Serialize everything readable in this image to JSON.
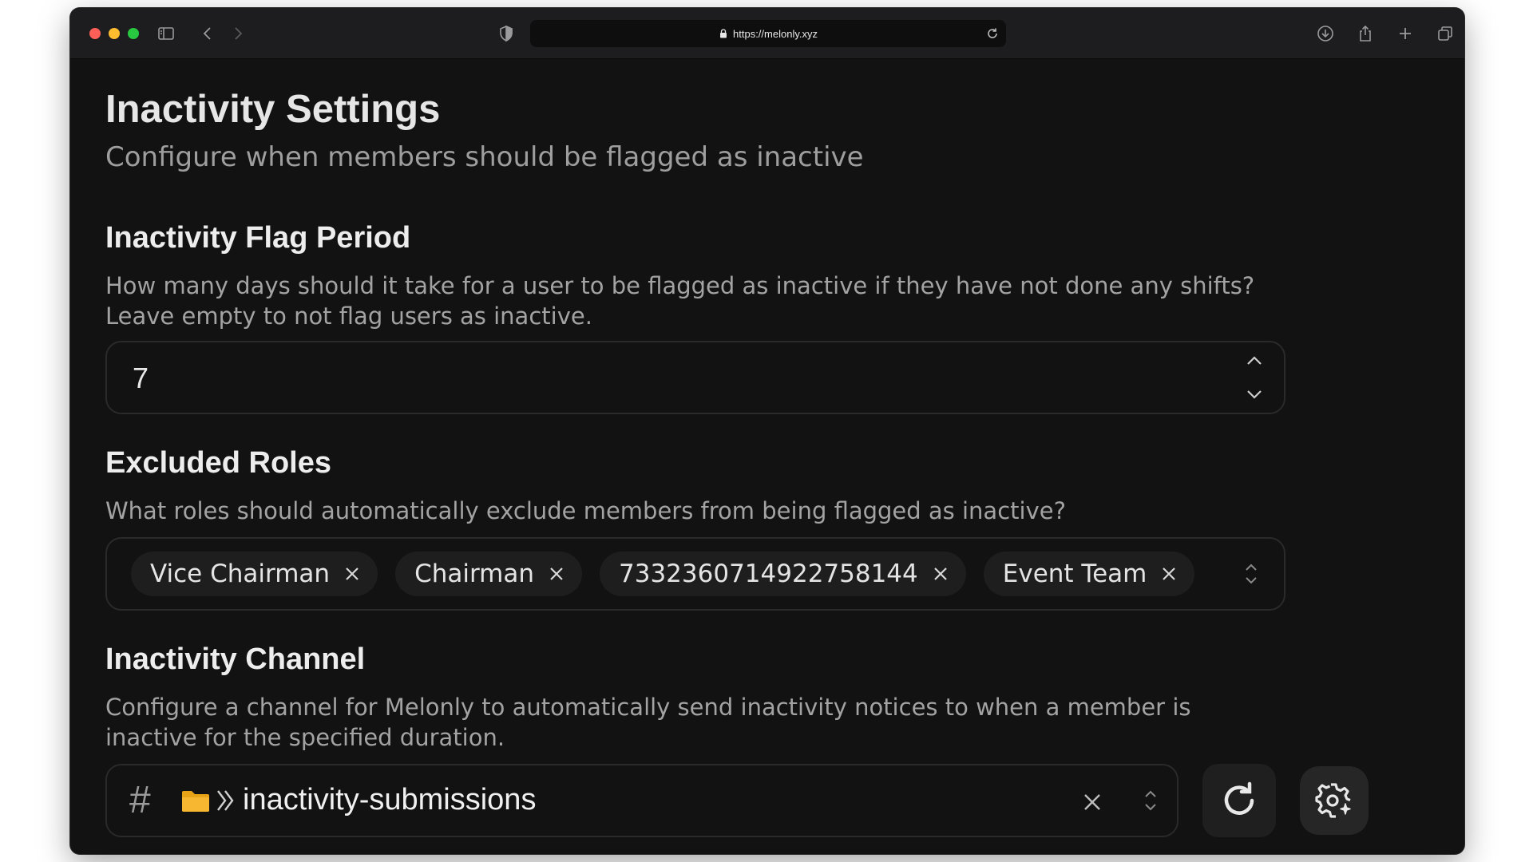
{
  "browser": {
    "url": "https://melonly.xyz",
    "icons": [
      "sidebar-icon",
      "back-icon",
      "forward-icon",
      "shield-icon",
      "lock-icon",
      "reload-icon",
      "download-icon",
      "share-icon",
      "new-tab-icon",
      "tabs-overview-icon"
    ]
  },
  "page": {
    "title": "Inactivity Settings",
    "subtitle": "Configure when members should be flagged as inactive"
  },
  "flag_period": {
    "title": "Inactivity Flag Period",
    "description_line1": "How many days should it take for a user to be flagged as inactive if they have not done any shifts?",
    "description_line2": "Leave empty to not flag users as inactive.",
    "value": "7"
  },
  "excluded_roles": {
    "title": "Excluded Roles",
    "description": "What roles should automatically exclude members from being flagged as inactive?",
    "roles": [
      "Vice Chairman",
      "Chairman",
      "733236071492275814​4",
      "Event Team"
    ]
  },
  "inactivity_channel": {
    "title": "Inactivity Channel",
    "description_line1": "Configure a channel for Melonly to automatically send inactivity notices to when a member is",
    "description_line2": "inactive for the specified duration.",
    "prefix_symbol": "#",
    "channel_name": "inactivity-submissions"
  },
  "colors": {
    "background": "#121212",
    "folder": "#f7b731"
  }
}
